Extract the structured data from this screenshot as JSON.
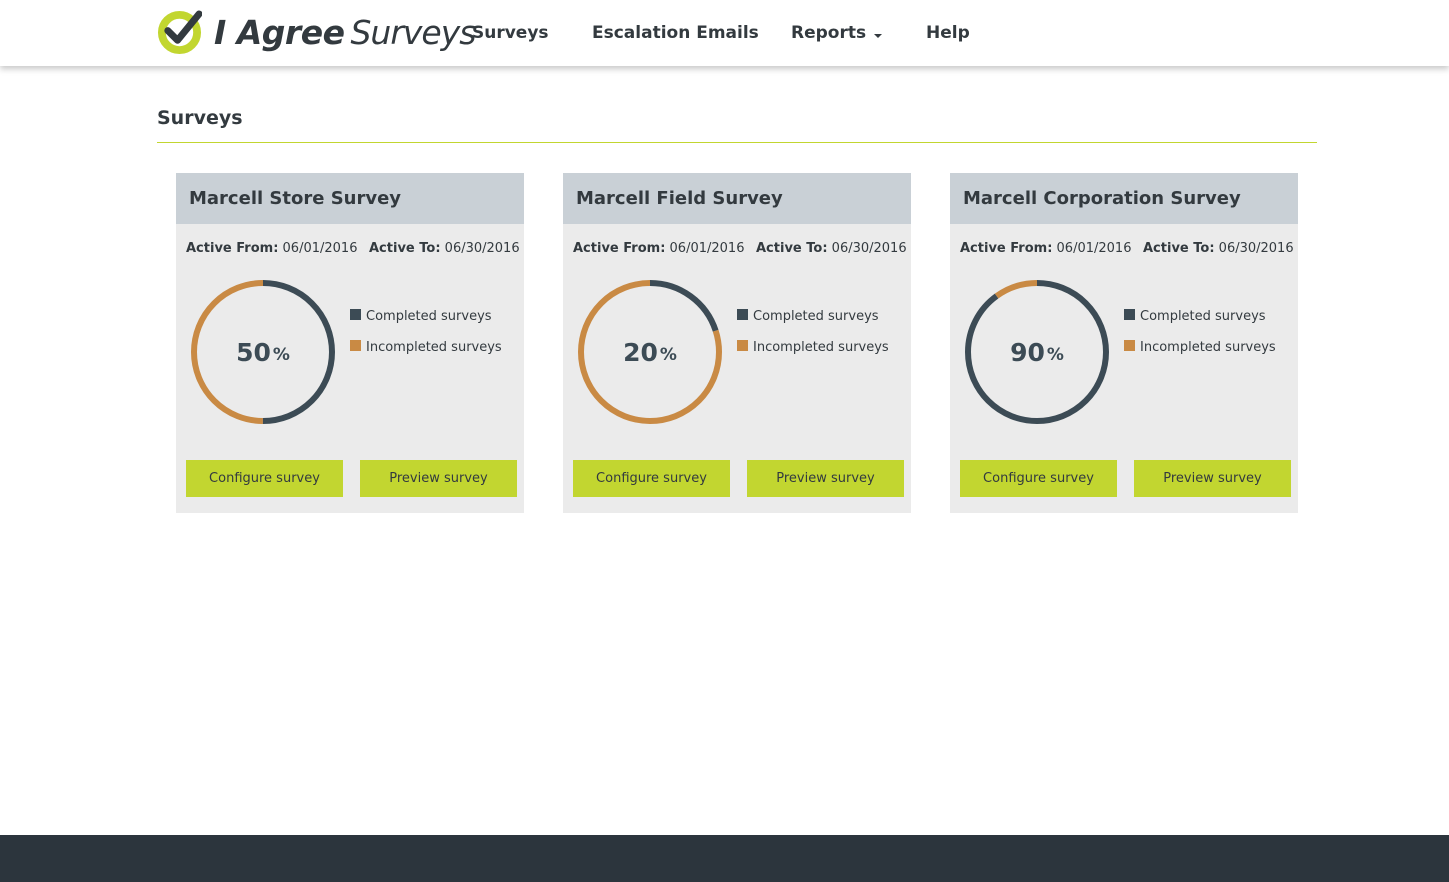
{
  "brand": {
    "name_bold": "I Agree",
    "name_light": "Surveys",
    "logo_icon": "checkmark-circle-icon",
    "accent_color": "#c2d630",
    "dark_color": "#333a3f"
  },
  "nav": {
    "items": [
      {
        "label": "Surveys"
      },
      {
        "label": "Escalation Emails"
      },
      {
        "label": "Reports"
      },
      {
        "label": "Help"
      }
    ]
  },
  "page": {
    "title": "Surveys"
  },
  "surveys": [
    {
      "title": "Marcell Store Survey",
      "active_from_label": "Active From:",
      "active_from": "06/01/2016",
      "active_to_label": "Active To:",
      "active_to": "06/30/2016",
      "percent": 50,
      "percent_label": "50",
      "percent_sign": "%",
      "legend_completed": "Completed surveys",
      "legend_incompleted": "Incompleted surveys",
      "configure_label": "Configure survey",
      "preview_label": "Preview survey"
    },
    {
      "title": "Marcell Field Survey",
      "active_from_label": "Active From:",
      "active_from": "06/01/2016",
      "active_to_label": "Active To:",
      "active_to": "06/30/2016",
      "percent": 20,
      "percent_label": "20",
      "percent_sign": "%",
      "legend_completed": "Completed surveys",
      "legend_incompleted": "Incompleted surveys",
      "configure_label": "Configure survey",
      "preview_label": "Preview survey"
    },
    {
      "title": "Marcell Corporation Survey",
      "active_from_label": "Active From:",
      "active_from": "06/01/2016",
      "active_to_label": "Active To:",
      "active_to": "06/30/2016",
      "percent": 90,
      "percent_label": "90",
      "percent_sign": "%",
      "legend_completed": "Completed surveys",
      "legend_incompleted": "Incompleted surveys",
      "configure_label": "Configure survey",
      "preview_label": "Preview survey"
    }
  ],
  "colors": {
    "completed": "#3c4b55",
    "incompleted": "#c98a44",
    "card_bg": "#ebebeb",
    "card_header_bg": "#c9d0d6",
    "footer_bg": "#2c353d"
  },
  "icons": {
    "reports_dropdown": "caret-down-icon"
  }
}
